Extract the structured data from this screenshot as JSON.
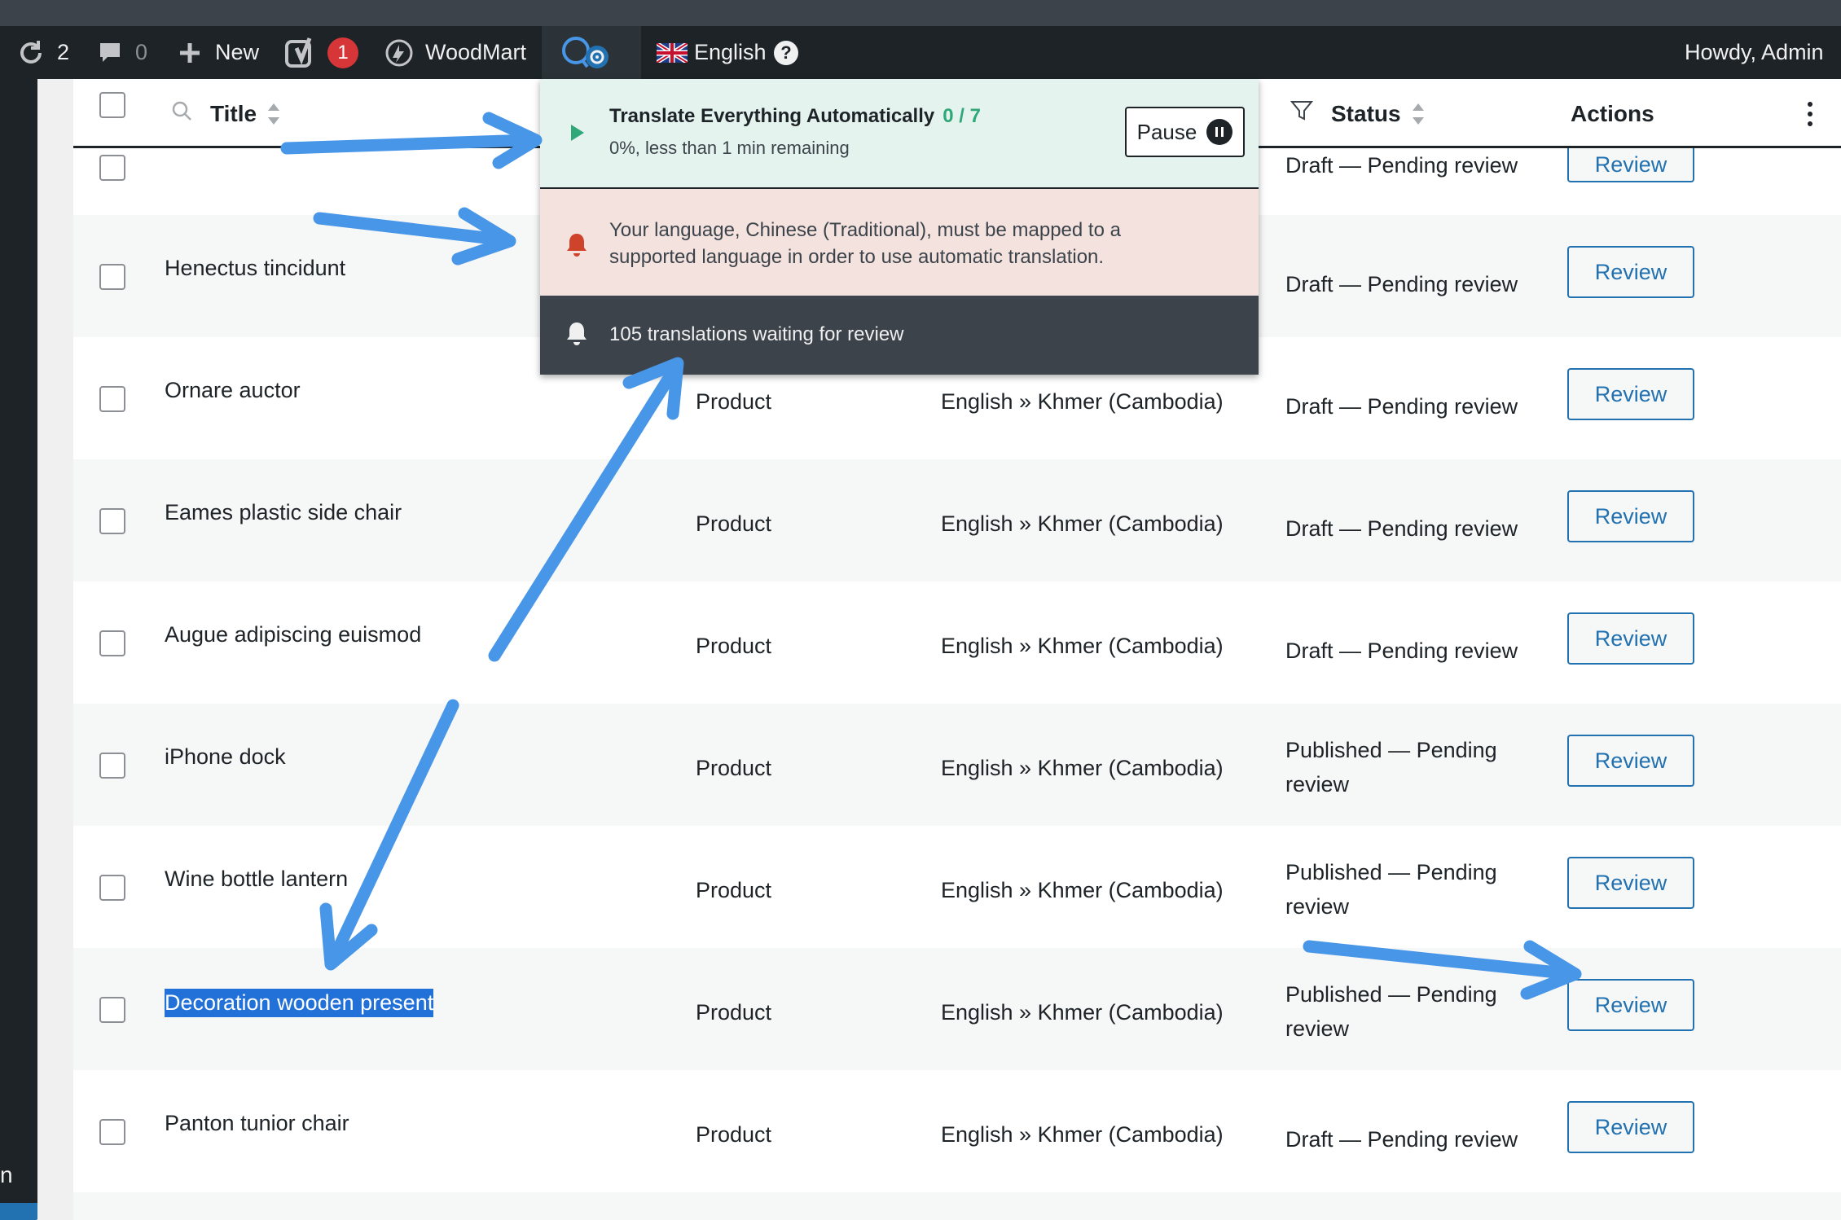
{
  "adminbar": {
    "updates_count": "2",
    "comments_count": "0",
    "new_label": "New",
    "yoast_badge": "1",
    "site_name": "WoodMart",
    "language_label": "English",
    "greeting": "Howdy, Admin"
  },
  "leftmenu": {
    "fragment": "n"
  },
  "table": {
    "headers": {
      "title": "Title",
      "status": "Status",
      "actions": "Actions"
    },
    "rows": [
      {
        "title": "",
        "type": "",
        "language": "",
        "status": "Draft — Pending review",
        "action": "Review"
      },
      {
        "title": "Henectus tincidunt",
        "type": "",
        "language": "",
        "status": "Draft — Pending review",
        "action": "Review"
      },
      {
        "title": "Ornare auctor",
        "type": "Product",
        "language": "English » Khmer (Cambodia)",
        "status": "Draft — Pending review",
        "action": "Review"
      },
      {
        "title": "Eames plastic side chair",
        "type": "Product",
        "language": "English » Khmer (Cambodia)",
        "status": "Draft — Pending review",
        "action": "Review"
      },
      {
        "title": "Augue adipiscing euismod",
        "type": "Product",
        "language": "English » Khmer (Cambodia)",
        "status": "Draft — Pending review",
        "action": "Review"
      },
      {
        "title": "iPhone dock",
        "type": "Product",
        "language": "English » Khmer (Cambodia)",
        "status": "Published — Pending review",
        "action": "Review"
      },
      {
        "title": "Wine bottle lantern",
        "type": "Product",
        "language": "English » Khmer (Cambodia)",
        "status": "Published — Pending review",
        "action": "Review"
      },
      {
        "title": "Decoration wooden present",
        "type": "Product",
        "language": "English » Khmer (Cambodia)",
        "status": "Published — Pending review",
        "action": "Review"
      },
      {
        "title": "Panton tunior chair",
        "type": "Product",
        "language": "English » Khmer (Cambodia)",
        "status": "Draft — Pending review",
        "action": "Review"
      }
    ]
  },
  "panel": {
    "auto_title": "Translate Everything Automatically",
    "auto_count": "0 / 7",
    "auto_progress": "0%, less than 1 min remaining",
    "pause_label": "Pause",
    "warning": "Your language, Chinese (Traditional), must be mapped to a supported language in order to use automatic translation.",
    "waiting": "105 translations waiting for review"
  },
  "colors": {
    "accent": "#2271b1",
    "annotation": "#4896e8",
    "success": "#2ea879",
    "warning_bell": "#d0432b"
  },
  "icons": [
    "updates-icon",
    "comments-icon",
    "plus-icon",
    "yoast-icon",
    "woodmart-icon",
    "wpml-icon",
    "gear-icon",
    "uk-flag-icon",
    "help-icon",
    "search-icon",
    "filter-icon",
    "more-icon",
    "play-icon",
    "pause-icon",
    "bell-icon"
  ]
}
